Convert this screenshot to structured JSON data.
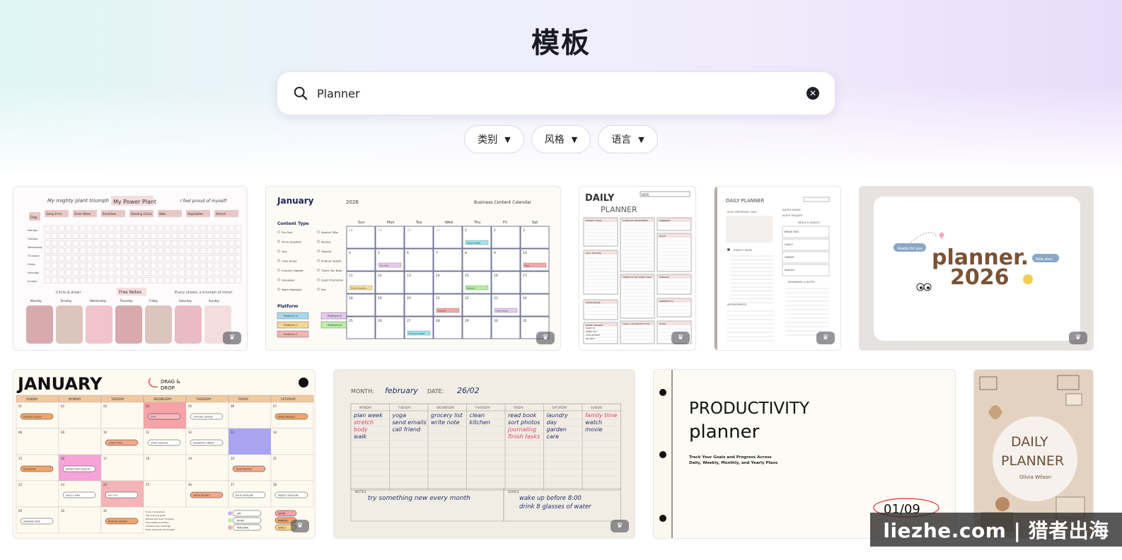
{
  "page": {
    "title": "模板"
  },
  "search": {
    "value": "Planner",
    "placeholder": ""
  },
  "filters": [
    {
      "label": "类别"
    },
    {
      "label": "风格"
    },
    {
      "label": "语言"
    }
  ],
  "templates": [
    {
      "id": "power-plant",
      "texts": {
        "top_left": "My mighty plant triumph",
        "title": "My Power Plant",
        "top_right": "I feel proud of myself!",
        "day": "Day",
        "habits": [
          "Sleep 8 hrs",
          "Drink Water",
          "Breakfast",
          "Reading 15min",
          "Walk",
          "Vegetables",
          "Stretch"
        ],
        "days": [
          "Monday",
          "Tuesday",
          "Wednesday",
          "Thursday",
          "Friday",
          "Saturday",
          "Sunday"
        ],
        "free_notes": "Free Notes",
        "circle": "Circle & draw!",
        "doodle": "Every stroke, a triumph of mine!"
      }
    },
    {
      "id": "business-calendar",
      "texts": {
        "month": "January",
        "year": "2026",
        "title": "Business Content Calendar",
        "content_type": "Content Type",
        "types": [
          "Fun Fact",
          "Special Offer",
          "Trivia Question",
          "Review",
          "Tips",
          "Tutorial",
          "Case Study",
          "Product Insight",
          "Industry Update",
          "Thank You Note",
          "Giveaway",
          "Event Promotion",
          "Team Highlight",
          "Poll"
        ],
        "platform": "Platform",
        "platforms": [
          "Platform A",
          "Platform B",
          "Platform C",
          "Platform D",
          "Platform F"
        ],
        "weekdays": [
          "Sun",
          "Mon",
          "Tue",
          "Wed",
          "Thu",
          "Fri",
          "Sat"
        ],
        "week1": [
          "28",
          "29",
          "30",
          "31",
          "1",
          "2",
          "3"
        ],
        "week2": [
          "4",
          "5",
          "6",
          "7",
          "8",
          "9",
          "10"
        ],
        "week3": [
          "11",
          "12",
          "13",
          "14",
          "15",
          "16",
          "17"
        ],
        "week4": [
          "18",
          "19",
          "20",
          "21",
          "22",
          "23",
          "24"
        ],
        "week5": [
          "25",
          "26",
          "27",
          "28",
          "29",
          "30",
          "31"
        ],
        "events": [
          "Special Offer",
          "Fun Fact",
          "Tips",
          "Trivia Question",
          "Review",
          "Tutorial",
          "Case Study",
          "Product Insight"
        ]
      }
    },
    {
      "id": "daily-planner-pink",
      "texts": {
        "title1": "DAILY",
        "title2": "PLANNER",
        "date": "DATE",
        "sections": [
          "PRIORITY TASKS",
          "SCHEDULE APPOINTMENT",
          "REMINDER",
          "MOOD",
          "GOAL TRACKER",
          "THINGS TO GET DONE TODAY",
          "EXERCISE",
          "WATER INTAKE",
          "REMINDER TO",
          "MONEY TRACKER",
          "TODAY I AM GRATEFUL FOR",
          "NOTES"
        ],
        "money": [
          "MONEY IN",
          "MONEY OUT",
          "TOTAL BUDGET",
          "BALANCE"
        ]
      }
    },
    {
      "id": "daily-planner-grey",
      "texts": {
        "title": "DAILY PLANNER",
        "date": "DATE",
        "important": "MOST IMPORTANT TASK",
        "water": "WATER INTAKE",
        "sleep": "SLEEP TRACKER",
        "meals": "MEALS & SNACKS",
        "meal_list": [
          "BREAK FAST",
          "LUNCH",
          "DINNER",
          "SNACKS"
        ],
        "tasks": "TODAY'S TASKS",
        "appointments": "APPOINTMENTS",
        "reminders": "REMINDERS & NOTES"
      }
    },
    {
      "id": "planner-2026",
      "texts": {
        "line1": "planner.",
        "line2": "2026",
        "tag_left": "Ready for you",
        "tag_right": "New start"
      }
    },
    {
      "id": "january-drag-drop",
      "texts": {
        "title": "JANUARY",
        "drag": "DRAG &",
        "drop": "DROP",
        "weekdays": [
          "SUNDAY",
          "MONDAY",
          "TUESDAY",
          "WEDNESDAY",
          "THURSDAY",
          "FRIDAY",
          "SATURDAY"
        ],
        "week1": [
          "01",
          "02",
          "03",
          "04",
          "05",
          "06",
          "07"
        ],
        "week2": [
          "08",
          "09",
          "10",
          "11",
          "12",
          "13",
          "14"
        ],
        "week3": [
          "15",
          "16",
          "17",
          "18",
          "19",
          "20",
          "21"
        ],
        "week4": [
          "22",
          "23",
          "24",
          "25",
          "26",
          "27",
          "28"
        ],
        "week5": [
          "29",
          "30",
          "31"
        ],
        "stickers": [
          "MONTHLY GOALS",
          "GYM",
          "CAPTURE CHANGE",
          "FAMILY BRUNCH",
          "CLIENT PITCH",
          "STUDY SESSION",
          "MARKETING SPRINT",
          "BUDGETING",
          "BRAINSTORM SESSION",
          "TEAM MEETING",
          "WALK & PARK",
          "DAY OUT",
          "GRADE PROJECT",
          "BOOK DEADLINE",
          "PROJECT DEADLINE",
          "WEEKEND PREP",
          "MONTHLY REVIEW",
          "URI",
          "WORK",
          "PERSONAL",
          "SHOW",
          "PARKING",
          "GOALS"
        ],
        "notes": [
          "To do / brainstorm",
          "Get morning goals",
          "Review and track progress",
          "Plan weekly priorities",
          "Schedule key meetings",
          "Track expenses and budget"
        ]
      }
    },
    {
      "id": "handwritten-planner",
      "texts": {
        "month_label": "MONTH:",
        "month_value": "february",
        "date_label": "DATE:",
        "date_value": "26/02",
        "weekdays": [
          "MONDAY",
          "TUESDAY",
          "WEDNESDAY",
          "THURSDAY",
          "FRIDAY",
          "SATURDAY",
          "SUNDAY"
        ],
        "col1": [
          "plan week",
          "stretch",
          "body",
          "walk"
        ],
        "col2": [
          "yoga",
          "send emails",
          "call friend"
        ],
        "col3": [
          "grocery list",
          "write note"
        ],
        "col4": [
          "clean",
          "kitchen"
        ],
        "col5": [
          "read book",
          "sort photos",
          "journaling",
          "finish tasks"
        ],
        "col6": [
          "laundry",
          "day",
          "garden",
          "care"
        ],
        "col7": [
          "family time",
          "watch",
          "movie"
        ],
        "notes_label": "NOTES",
        "notes_value": "try something new every month",
        "goals_label": "GOALS",
        "goals": [
          "wake up before 8:00",
          "drink 8 glasses of water"
        ]
      }
    },
    {
      "id": "productivity-planner",
      "texts": {
        "line1": "PRODUCTIVITY",
        "line2": "planner",
        "sub1": "Track Your Goals and Progress Across",
        "sub2": "Daily, Weekly, Monthly, and Yearly Plans",
        "page": "01/09"
      }
    },
    {
      "id": "daily-planner-olivia",
      "texts": {
        "line1": "DAILY",
        "line2": "PLANNER",
        "name": "Olivia Wilson"
      }
    }
  ],
  "premium_badge": "♛",
  "watermark": "liezhe.com | 猎者出海"
}
